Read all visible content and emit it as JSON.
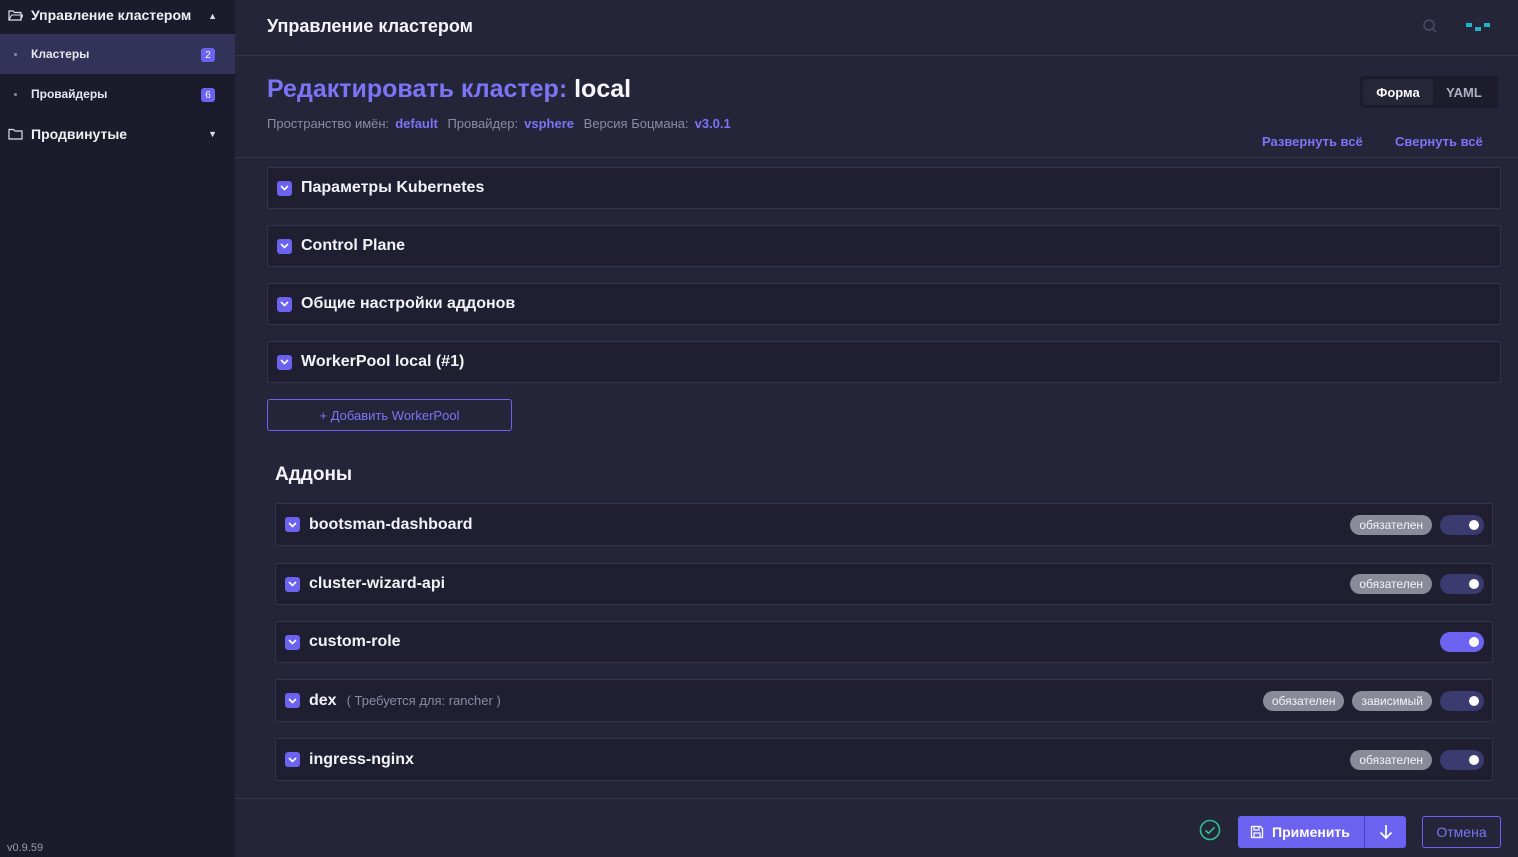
{
  "sidebar": {
    "group1": {
      "label": "Управление кластером"
    },
    "items": [
      {
        "label": "Кластеры",
        "badge": "2"
      },
      {
        "label": "Провайдеры",
        "badge": "6"
      }
    ],
    "group2": {
      "label": "Продвинутые"
    },
    "version": "v0.9.59"
  },
  "header": {
    "title": "Управление кластером"
  },
  "page": {
    "title_prefix": "Редактировать кластер:",
    "title_name": "local",
    "meta": {
      "namespace_label": "Пространство имён:",
      "namespace_value": "default",
      "provider_label": "Провайдер:",
      "provider_value": "vsphere",
      "version_label": "Версия Боцмана:",
      "version_value": "v3.0.1"
    },
    "mode": {
      "form": "Форма",
      "yaml": "YAML"
    },
    "expand_all": "Развернуть всё",
    "collapse_all": "Свернуть всё"
  },
  "sections": [
    "Параметры Kubernetes",
    "Control Plane",
    "Общие настройки аддонов",
    "WorkerPool local (#1)"
  ],
  "add_workerpool": "+ Добавить WorkerPool",
  "addons": {
    "title": "Аддоны",
    "items": [
      {
        "name": "bootsman-dashboard",
        "hint": "",
        "pills": [
          "обязателен"
        ],
        "enabled": true
      },
      {
        "name": "cluster-wizard-api",
        "hint": "",
        "pills": [
          "обязателен"
        ],
        "enabled": true
      },
      {
        "name": "custom-role",
        "hint": "",
        "pills": [],
        "enabled": true
      },
      {
        "name": "dex",
        "hint": "( Требуется для: rancher )",
        "pills": [
          "обязателен",
          "зависимый"
        ],
        "enabled": true
      },
      {
        "name": "ingress-nginx",
        "hint": "",
        "pills": [
          "обязателен"
        ],
        "enabled": true
      }
    ]
  },
  "footer": {
    "apply": "Применить",
    "cancel": "Отмена"
  },
  "colors": {
    "accent": "#6b63ef",
    "background": "#25253a",
    "sidebar": "#1b1b2b"
  }
}
